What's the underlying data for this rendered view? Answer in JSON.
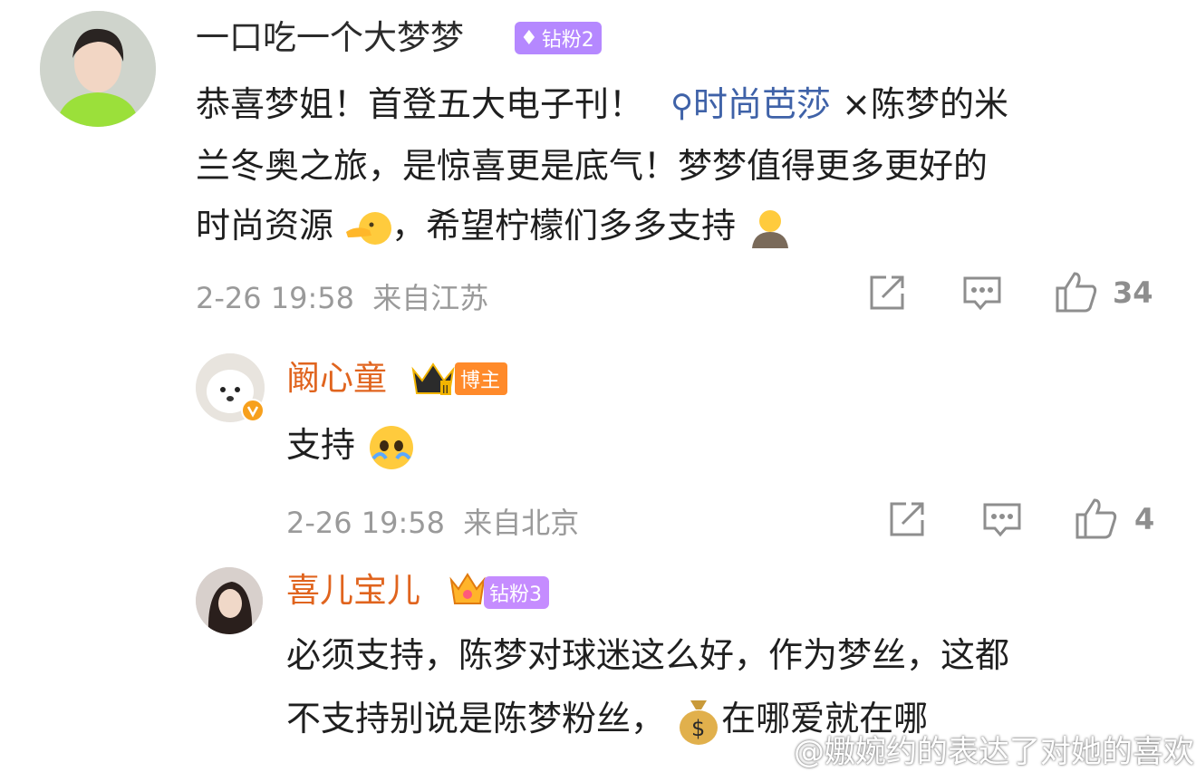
{
  "comments": [
    {
      "username": "一口吃一个大梦梦",
      "badge": {
        "label": "钻粉2",
        "color": "#b588ff"
      },
      "text": {
        "line1_a": "恭喜梦姐！首登五大电子刊！",
        "topic": "时尚芭莎",
        "line1_b": "×陈梦的米",
        "line2": "兰冬奥之旅，是惊喜更是底气！梦梦值得更多更好的",
        "line3_a": "时尚资源",
        "line3_b": "，希望柠檬们多多支持"
      },
      "time": "2-26 19:58",
      "location": "来自江苏",
      "likes": "34"
    },
    {
      "username": "阚心童",
      "badge": {
        "label": "博主",
        "color": "#ff8a2a"
      },
      "text": {
        "line1": "支持"
      },
      "time": "2-26 19:58",
      "location": "来自北京",
      "likes": "4"
    },
    {
      "username": "喜儿宝儿",
      "badge": {
        "label": "钻粉3",
        "color": "#c58cff"
      },
      "text": {
        "line1": "必须支持，陈梦对球迷这么好，作为梦丝，这都",
        "line2_a": "不支持别说是陈梦粉丝，",
        "line2_b": "在哪爱就在哪"
      }
    }
  ],
  "watermark": "@嫐婉约的表达了对她的喜欢",
  "colors": {
    "username": "#e0641e",
    "meta": "#9a9a9a",
    "topic": "#3f62a8"
  },
  "icons": [
    "repost-icon",
    "comment-icon",
    "like-icon",
    "search-icon",
    "money-bag-icon"
  ]
}
